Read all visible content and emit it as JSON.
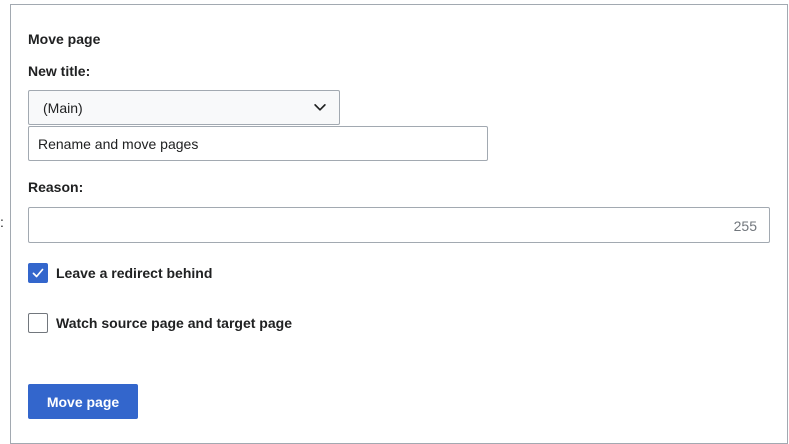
{
  "stray_text": ":",
  "form": {
    "legend": "Move page",
    "new_title_label": "New title:",
    "namespace_selected": "(Main)",
    "title_value": "Rename and move pages",
    "reason_label": "Reason:",
    "reason_value": "",
    "reason_char_remaining": "255",
    "leave_redirect_label": "Leave a redirect behind",
    "leave_redirect_checked": true,
    "watch_label": "Watch source page and target page",
    "watch_checked": false,
    "submit_label": "Move page"
  },
  "colors": {
    "accent": "#3366cc",
    "border": "#a2a9b1",
    "text": "#202122",
    "muted": "#72777d"
  },
  "icons": {
    "namespace_dropdown": "chevron-down-icon",
    "checkbox_checked": "checkmark-icon"
  }
}
